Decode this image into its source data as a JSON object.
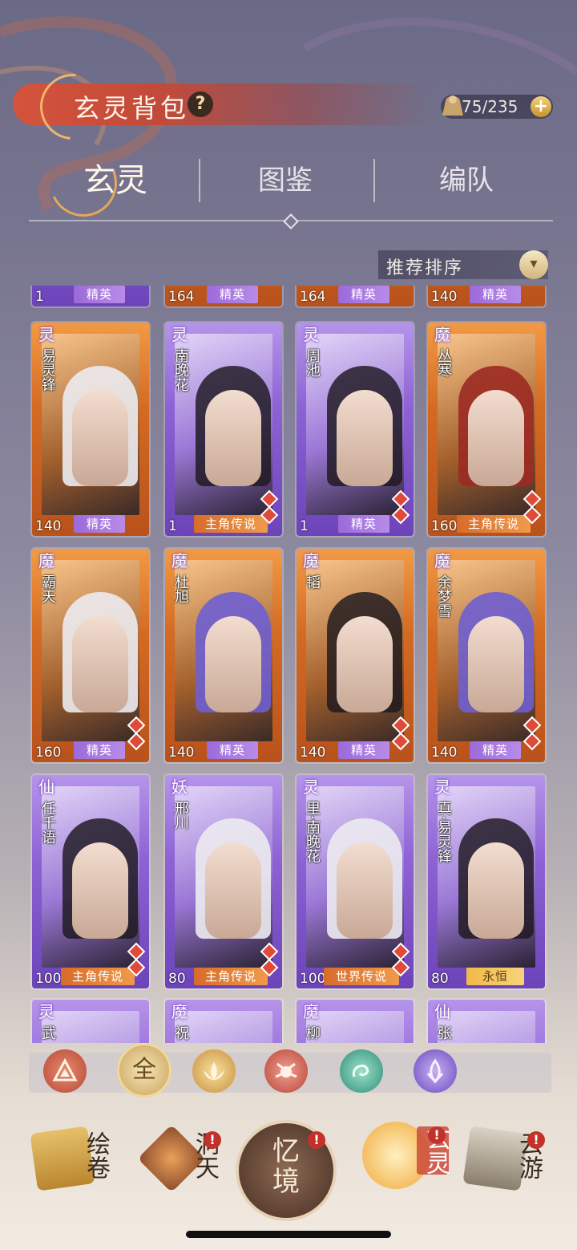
{
  "header": {
    "title": "玄灵背包",
    "help": "?",
    "capacity": "75/235",
    "add": "+"
  },
  "tabs": [
    {
      "label": "玄灵"
    },
    {
      "label": "图鉴"
    },
    {
      "label": "编队"
    }
  ],
  "sort": {
    "label": "推荐排序",
    "arrow": "▾"
  },
  "top_partial": [
    {
      "level": "1",
      "rank": "精英"
    },
    {
      "level": "164",
      "rank": "精英"
    },
    {
      "level": "164",
      "rank": "精英"
    },
    {
      "level": "140",
      "rank": "精英"
    }
  ],
  "cards": [
    {
      "elem": "灵",
      "name": "易灵锋",
      "level": "140",
      "rank": "精英"
    },
    {
      "elem": "灵",
      "name": "南晚花",
      "level": "1",
      "rank": "主角传说"
    },
    {
      "elem": "灵",
      "name": "周池",
      "level": "1",
      "rank": "精英"
    },
    {
      "elem": "魔",
      "name": "丛寒",
      "level": "160",
      "rank": "主角传说"
    },
    {
      "elem": "魔",
      "name": "霸天",
      "level": "160",
      "rank": "精英"
    },
    {
      "elem": "魔",
      "name": "杜旭",
      "level": "140",
      "rank": "精英"
    },
    {
      "elem": "魔",
      "name": "韬",
      "level": "140",
      "rank": "精英"
    },
    {
      "elem": "魔",
      "name": "余梦雪",
      "level": "140",
      "rank": "精英"
    },
    {
      "elem": "仙",
      "name": "任千语",
      "level": "100",
      "rank": "主角传说"
    },
    {
      "elem": "妖",
      "name": "邢川",
      "level": "80",
      "rank": "主角传说"
    },
    {
      "elem": "灵",
      "name": "里·南晚花",
      "level": "100",
      "rank": "世界传说"
    },
    {
      "elem": "灵",
      "name": "真·易灵锋",
      "level": "80",
      "rank": "永恒"
    }
  ],
  "bottom_partial": [
    {
      "elem": "灵",
      "name": "武"
    },
    {
      "elem": "魔",
      "name": "祝"
    },
    {
      "elem": "魔",
      "name": "柳"
    },
    {
      "elem": "仙",
      "name": "张"
    }
  ],
  "filters": {
    "all": "全"
  },
  "nav": [
    {
      "label": "绘卷",
      "icon": "scroll-icon"
    },
    {
      "label": "洞天",
      "icon": "lotus-icon",
      "badge": "!"
    },
    {
      "label": "忆境",
      "icon": "memory-icon",
      "badge": "!"
    },
    {
      "label": "玄灵",
      "icon": "spirit-icon",
      "badge": "!"
    },
    {
      "label": "云游",
      "icon": "travel-icon",
      "badge": "!"
    }
  ]
}
